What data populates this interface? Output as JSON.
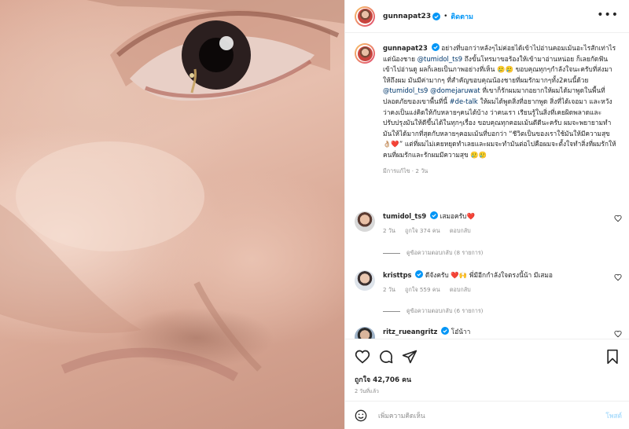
{
  "post": {
    "username": "gunnapat23",
    "follow_label": "ติดตาม",
    "more_label": "•••",
    "caption": {
      "username": "gunnapat23",
      "part1": "อย่างที่บอกว่าหลังๆไม่ค่อยได้เข้าไปอ่านคอมเม้นอะไรสักเท่าไร แต่น้องชาย",
      "mention1": "@tumidol_ts9",
      "part2": "ถึงขั้นโทรมาขอร้องให้เข้ามาอ่านหน่อย ก็เลยกัดฟันเข้าไปอ่านดู ผลก็เลยเป็นภาพอย่างที่เห็น 🥲🥲 ขอบคุณทุกๆกำลังใจนะครับที่ส่งมาให้ถึงผม มันมีค่ามากๆ ที่สำคัญขอบคุณน้องชายที่ผมรักมากๆทั้ง2คนนี้ด้วย",
      "mention2": "@tumidol_ts9",
      "mention3": "@domejaruwat",
      "part3": "ที่เขาก็รักผมมากอยากให้ผมได้มาพูดในพื้นที่ปลอดภัยของเขาพื้นที่นี้",
      "hashtag": "#de-talk",
      "part4": "ให้ผมได้พูดสิ่งที่อยากพูด สิ่งที่ได้เจอมา และหวังว่าคงเป็นแง่คิดให้กับหลายๆคนได้บ้าง ว่าคนเรา เรียนรู้ในสิ่งที่เคยผิดพลาดและปรับปรุงมันให้ดีขึ้นได้ในทุกๆเรื่อง ขอบคุณทุกคอมเม้นดีดีนะครับ ผมจะพยายามทำมันให้ได้มากที่สุดกับหลายๆคอมเม้นที่บอกว่า “ชีวิตเป็นของเราใช้มันให้มีความสุข 👌🏼❤️” แต่ที่ผมไม่เคยหยุดทำเลยและผมจะทำมันต่อไปคือผมจะตั้งใจทำสิ่งที่ผมรักให้คนที่ผมรักและรักผมมีความสุข 🥲🥲",
      "meta": "มีการแก้ไข · 2 วัน"
    },
    "comments": [
      {
        "username": "tumidol_ts9",
        "text": "เสมอครับ❤️",
        "time": "2 วัน",
        "likes": "ถูกใจ 374 คน",
        "reply": "ตอบกลับ",
        "view_replies": "ดูข้อความตอบกลับ (8 รายการ)"
      },
      {
        "username": "kristtps",
        "text": "ดีจังครับ ❤️🙌 พี่มีอีกกำลังใจตรงนี้น้า มีเสมอ",
        "time": "2 วัน",
        "likes": "ถูกใจ 559 คน",
        "reply": "ตอบกลับ",
        "view_replies": "ดูข้อความตอบกลับ (6 รายการ)"
      },
      {
        "username": "ritz_rueangritz",
        "text": "โอ๋น้าา"
      }
    ],
    "likes_total": "ถูกใจ 42,706 คน",
    "posted_ago": "2 วันที่แล้ว",
    "add_comment_placeholder": "เพิ่มความคิดเห็น",
    "post_button": "โพสต์"
  },
  "colors": {
    "link": "#00376b",
    "follow": "#0095f6",
    "verified": "#0095f6",
    "muted": "#8e8e8e",
    "post_disabled": "#b2dffc"
  }
}
